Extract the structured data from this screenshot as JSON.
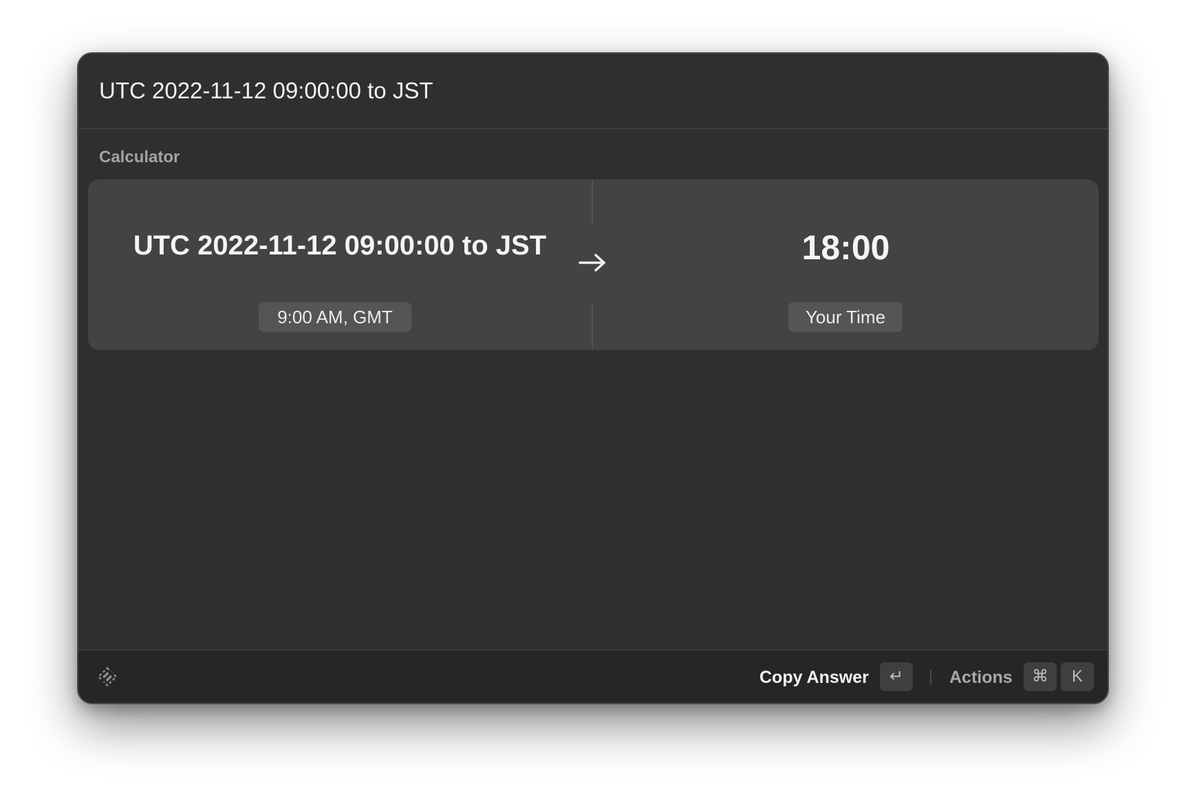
{
  "search": {
    "query": "UTC 2022-11-12 09:00:00 to JST"
  },
  "section": {
    "label": "Calculator"
  },
  "calculator": {
    "expression": "UTC 2022-11-12 09:00:00 to JST",
    "input_caption": "9:00 AM, GMT",
    "result": "18:00",
    "result_caption": "Your Time",
    "arrow_icon": "arrow-right-icon"
  },
  "footer": {
    "logo_icon": "app-logo-icon",
    "primary_action": "Copy Answer",
    "primary_shortcut": "↵",
    "actions_label": "Actions",
    "actions_shortcut_modifier": "⌘",
    "actions_shortcut_key": "K"
  },
  "colors": {
    "window_bg": "#2f2f2f",
    "card_bg": "#434343",
    "footer_bg": "#262626",
    "text_primary": "#f2f2f2",
    "text_secondary": "#a3a3a3"
  }
}
